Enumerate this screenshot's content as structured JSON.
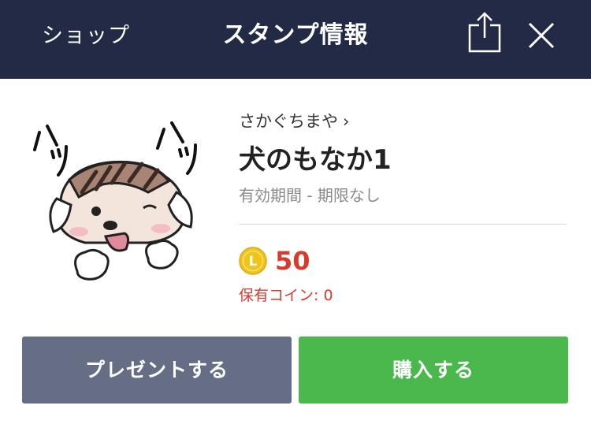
{
  "header": {
    "back_label": "ショップ",
    "title": "スタンプ情報"
  },
  "sticker": {
    "text_left": "ハッ",
    "text_right": "ハッ"
  },
  "product": {
    "author": "さかぐちまや",
    "name": "犬のもなか1",
    "validity": "有効期間 - 期限なし",
    "coin_letter": "L",
    "price": "50",
    "owned_label": "保有コイン: ",
    "owned_value": "0"
  },
  "actions": {
    "gift_label": "プレゼントする",
    "buy_label": "購入する"
  },
  "colors": {
    "header_bg": "#232a45",
    "price": "#d63b2b",
    "gift_button": "#666e85",
    "buy_button": "#4bb84d",
    "coin": "#f0c419"
  }
}
